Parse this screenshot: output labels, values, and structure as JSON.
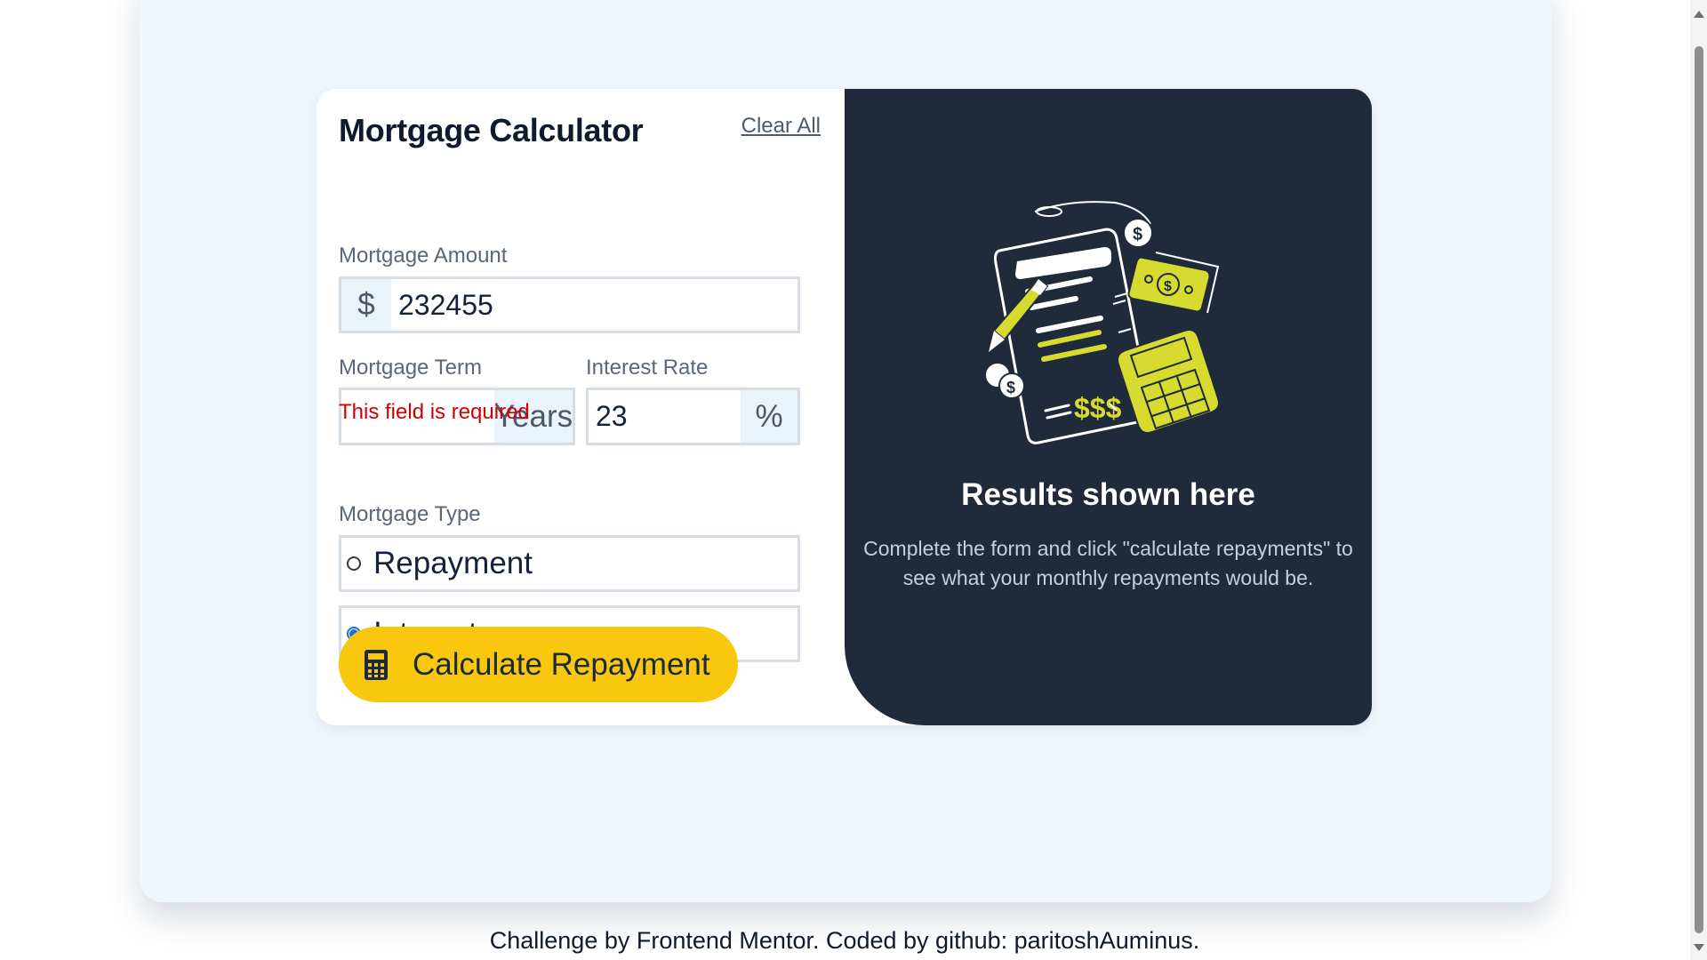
{
  "calculator": {
    "title": "Mortgage Calculator",
    "clear_all_label": "Clear All",
    "amount": {
      "label": "Mortgage Amount",
      "prefix": "$",
      "value": "232455"
    },
    "term": {
      "label": "Mortgage Term",
      "suffix": "Years",
      "value": "",
      "error": "This field is required"
    },
    "rate": {
      "label": "Interest Rate",
      "suffix": "%",
      "value": "23"
    },
    "type": {
      "label": "Mortgage Type",
      "options": [
        {
          "label": "Repayment",
          "checked": false
        },
        {
          "label": "Interest",
          "checked": true
        }
      ]
    },
    "submit_label": "Calculate Repayment",
    "submit_icon": "calculator-icon"
  },
  "results": {
    "illustration": "empty-results-illustration",
    "title": "Results shown here",
    "description": "Complete the form and click \"calculate repayments\" to see what your monthly repayments would be."
  },
  "footer": {
    "text": "Challenge by Frontend Mentor. Coded by github: paritoshAuminus."
  },
  "colors": {
    "page_bg": "#eff6fc",
    "card_bg": "#ffffff",
    "results_bg": "#1f2a3b",
    "accent": "#f9c80e",
    "illustration_accent": "#d8db2f",
    "error": "#d20000",
    "radio_checked": "#1870d6"
  }
}
